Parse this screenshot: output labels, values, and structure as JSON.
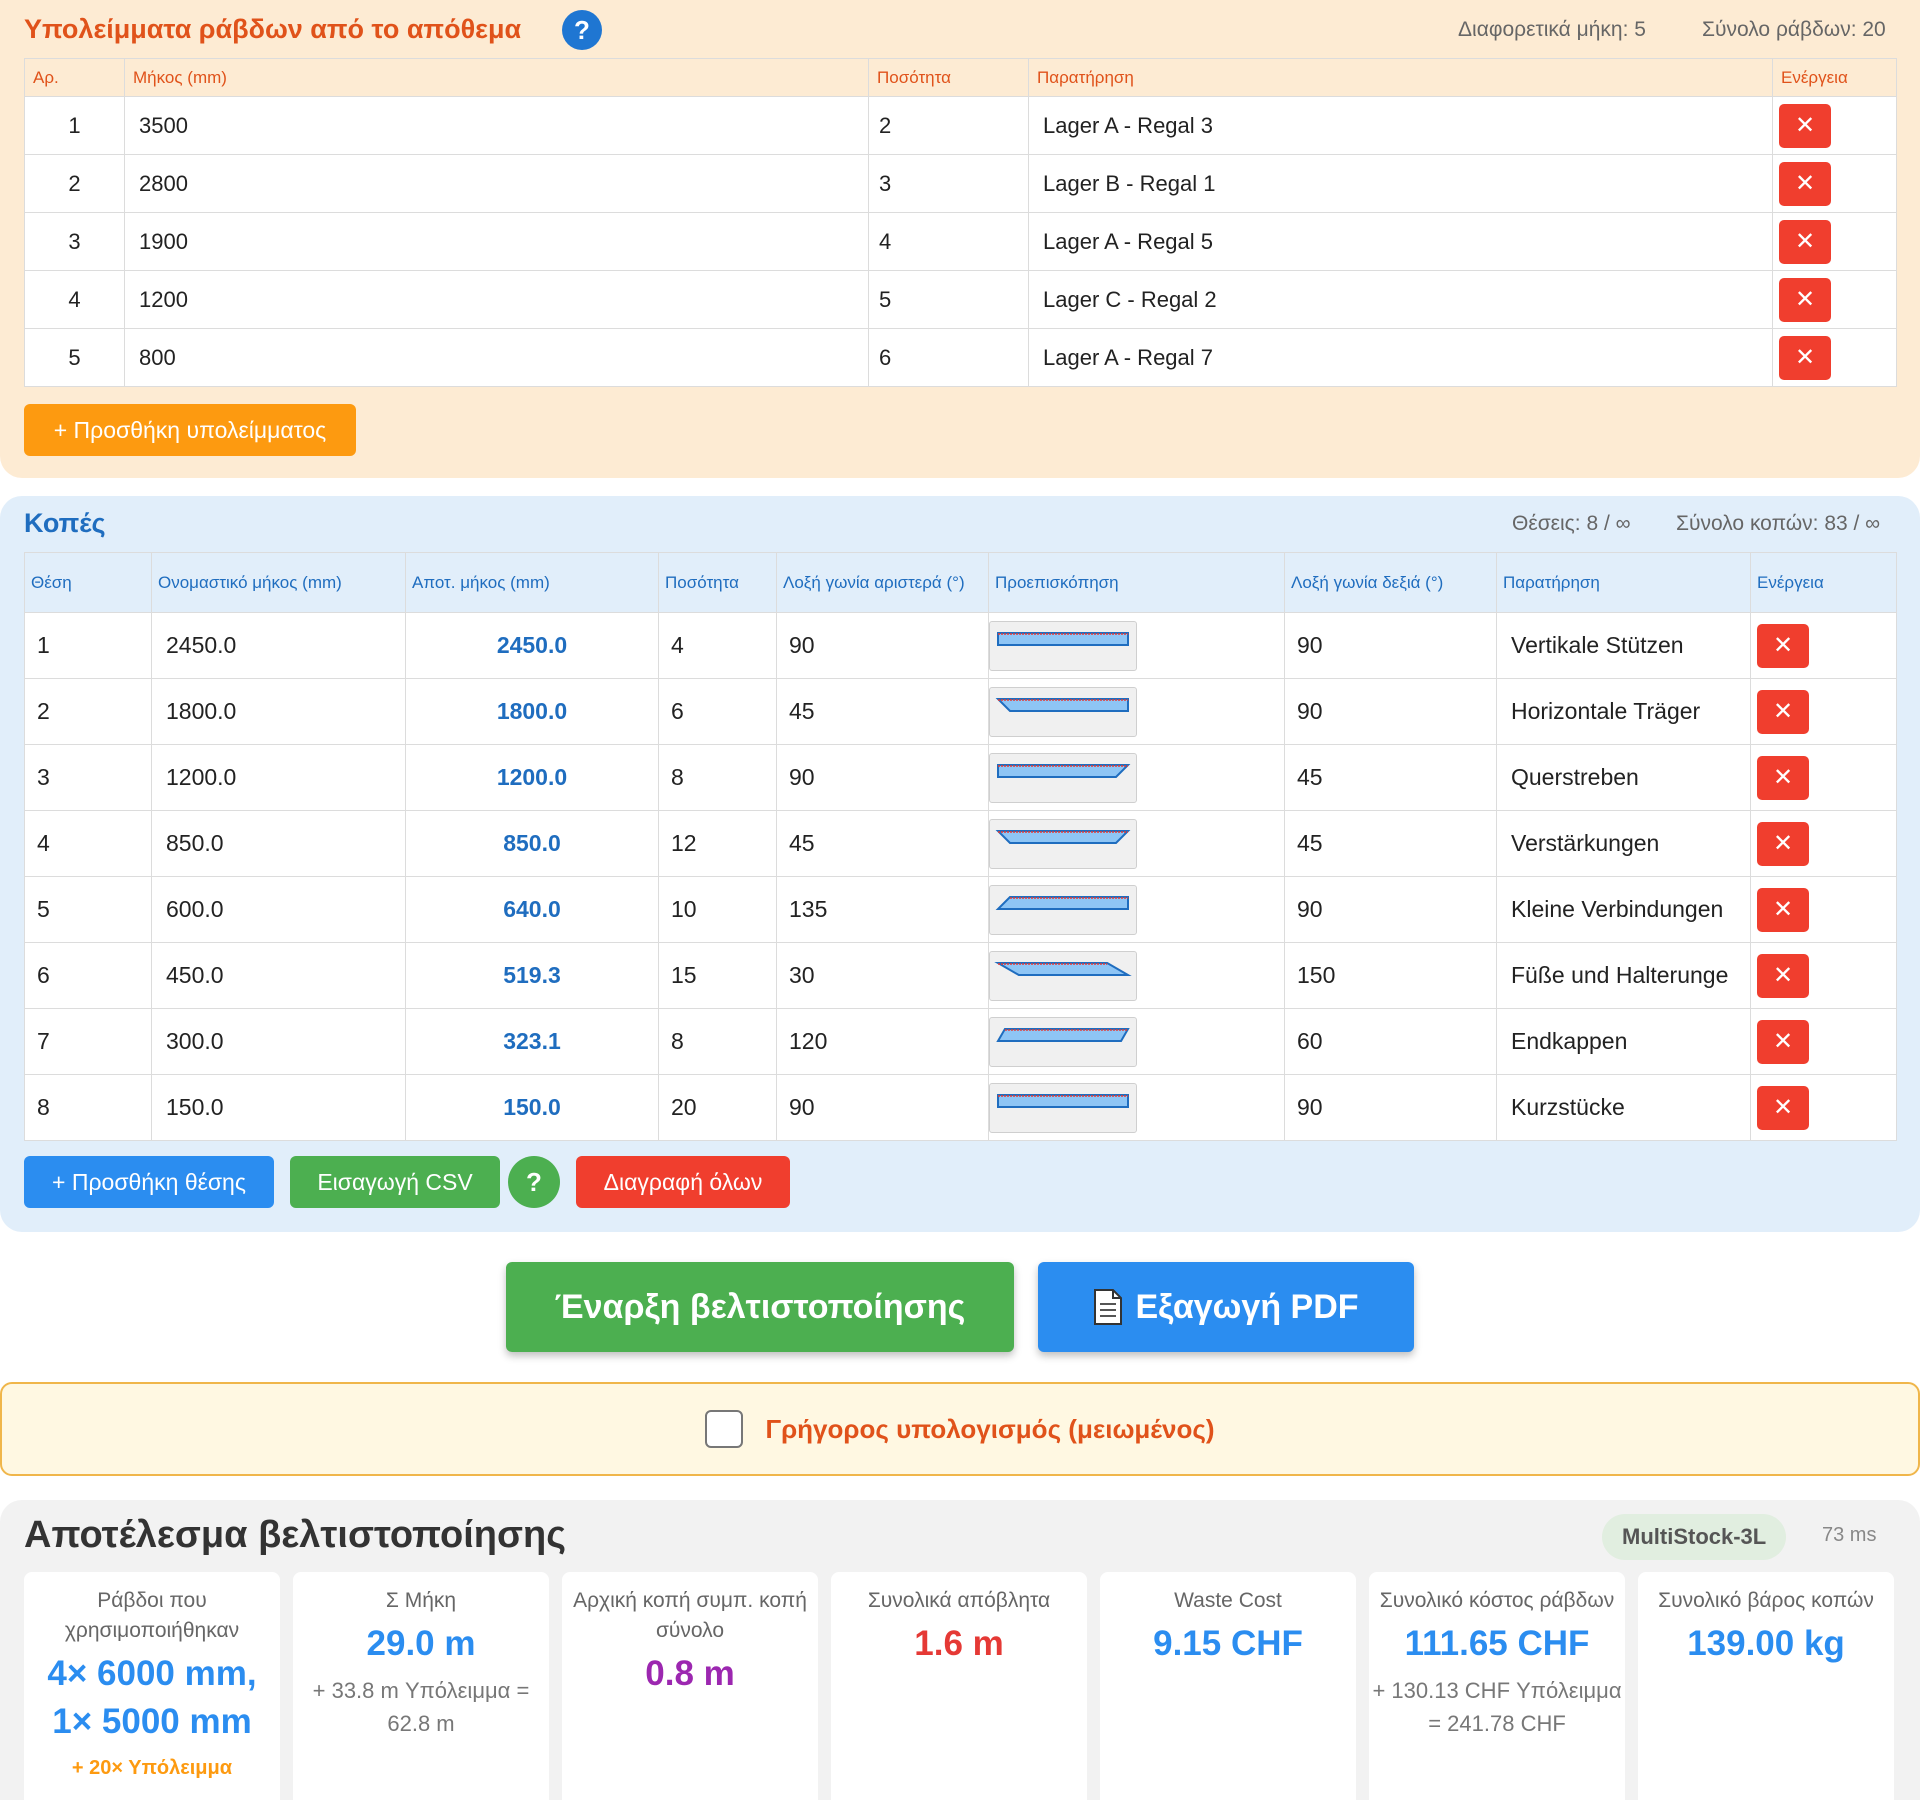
{
  "stock": {
    "title": "Υπολείμματα ράβδων από το απόθεμα",
    "help": "?",
    "stat_lengths": "Διαφορετικά μήκη: 5",
    "stat_total": "Σύνολο ράβδων: 20",
    "headers": [
      "Αρ.",
      "Μήκος (mm)",
      "Ποσότητα",
      "Παρατήρηση",
      "Ενέργεια"
    ],
    "rows": [
      {
        "no": "1",
        "length": "3500",
        "qty": "2",
        "note": "Lager A - Regal 3"
      },
      {
        "no": "2",
        "length": "2800",
        "qty": "3",
        "note": "Lager B - Regal 1"
      },
      {
        "no": "3",
        "length": "1900",
        "qty": "4",
        "note": "Lager A - Regal 5"
      },
      {
        "no": "4",
        "length": "1200",
        "qty": "5",
        "note": "Lager C - Regal 2"
      },
      {
        "no": "5",
        "length": "800",
        "qty": "6",
        "note": "Lager A - Regal 7"
      }
    ],
    "add_label": "+ Προσθήκη υπολείμματος"
  },
  "cuts": {
    "title": "Κοπές",
    "stat_positions": "Θέσεις: 8 / ∞",
    "stat_total": "Σύνολο κοπών: 83 / ∞",
    "headers": [
      "Θέση",
      "Ονομαστικό μήκος (mm)",
      "Αποτ. μήκος (mm)",
      "Ποσότητα",
      "Λοξή γωνία αριστερά (°)",
      "Προεπισκόπηση",
      "Λοξή γωνία δεξιά (°)",
      "Παρατήρηση",
      "Ενέργεια"
    ],
    "rows": [
      {
        "pos": "1",
        "nominal": "2450.0",
        "effective": "2450.0",
        "qty": "4",
        "left": "90",
        "right": "90",
        "note": "Vertikale Stützen"
      },
      {
        "pos": "2",
        "nominal": "1800.0",
        "effective": "1800.0",
        "qty": "6",
        "left": "45",
        "right": "90",
        "note": "Horizontale Träger"
      },
      {
        "pos": "3",
        "nominal": "1200.0",
        "effective": "1200.0",
        "qty": "8",
        "left": "90",
        "right": "45",
        "note": "Querstreben"
      },
      {
        "pos": "4",
        "nominal": "850.0",
        "effective": "850.0",
        "qty": "12",
        "left": "45",
        "right": "45",
        "note": "Verstärkungen"
      },
      {
        "pos": "5",
        "nominal": "600.0",
        "effective": "640.0",
        "qty": "10",
        "left": "135",
        "right": "90",
        "note": "Kleine Verbindungen"
      },
      {
        "pos": "6",
        "nominal": "450.0",
        "effective": "519.3",
        "qty": "15",
        "left": "30",
        "right": "150",
        "note": "Füße und Halterunge"
      },
      {
        "pos": "7",
        "nominal": "300.0",
        "effective": "323.1",
        "qty": "8",
        "left": "120",
        "right": "60",
        "note": "Endkappen"
      },
      {
        "pos": "8",
        "nominal": "150.0",
        "effective": "150.0",
        "qty": "20",
        "left": "90",
        "right": "90",
        "note": "Kurzstücke"
      }
    ],
    "add_label": "+ Προσθήκη θέσης",
    "import_label": "Εισαγωγή CSV",
    "help": "?",
    "delete_all_label": "Διαγραφή όλων"
  },
  "actions": {
    "optimize_label": "Έναρξη βελτιστοποίησης",
    "pdf_label": "Εξαγωγή PDF",
    "pdf_icon": "document-icon"
  },
  "fast_calc": {
    "label": "Γρήγορος υπολογισμός (μειωμένος)",
    "checked": false
  },
  "result": {
    "title": "Αποτέλεσμα βελτιστοποίησης",
    "algorithm": "MultiStock-3L",
    "time": "73 ms",
    "cards": [
      {
        "label": "Ράβδοι που χρησιμοποιήθηκαν",
        "value": "4× 6000 mm, 1× 5000 mm",
        "sub": "+ 20× Υπόλειμμα",
        "color": "#2b8df0"
      },
      {
        "label": "Σ Μήκη",
        "value": "29.0 m",
        "sub": "+ 33.8 m Υπόλειμμα = 62.8 m",
        "color": "#2b8df0"
      },
      {
        "label": "Αρχική κοπή συμπ. κοπή σύνολο",
        "value": "0.8 m",
        "sub": "",
        "color": "#9c27b0"
      },
      {
        "label": "Συνολικά απόβλητα",
        "value": "1.6 m",
        "sub": "",
        "color": "#e53935"
      },
      {
        "label": "Waste Cost",
        "value": "9.15 CHF",
        "sub": "",
        "color": "#2b8df0"
      },
      {
        "label": "Συνολικό κόστος ράβδων",
        "value": "111.65 CHF",
        "sub": "+ 130.13 CHF Υπόλειμμα = 241.78 CHF",
        "color": "#2b8df0"
      },
      {
        "label": "Συνολικό βάρος κοπών",
        "value": "139.00 kg",
        "sub": "",
        "color": "#2b8df0"
      }
    ]
  },
  "colors": {
    "orange": "#e0521a",
    "blue": "#1f6dbf",
    "delete_red": "#f03e2e",
    "green": "#4caf50",
    "leftover_orange": "#fd9a10"
  }
}
